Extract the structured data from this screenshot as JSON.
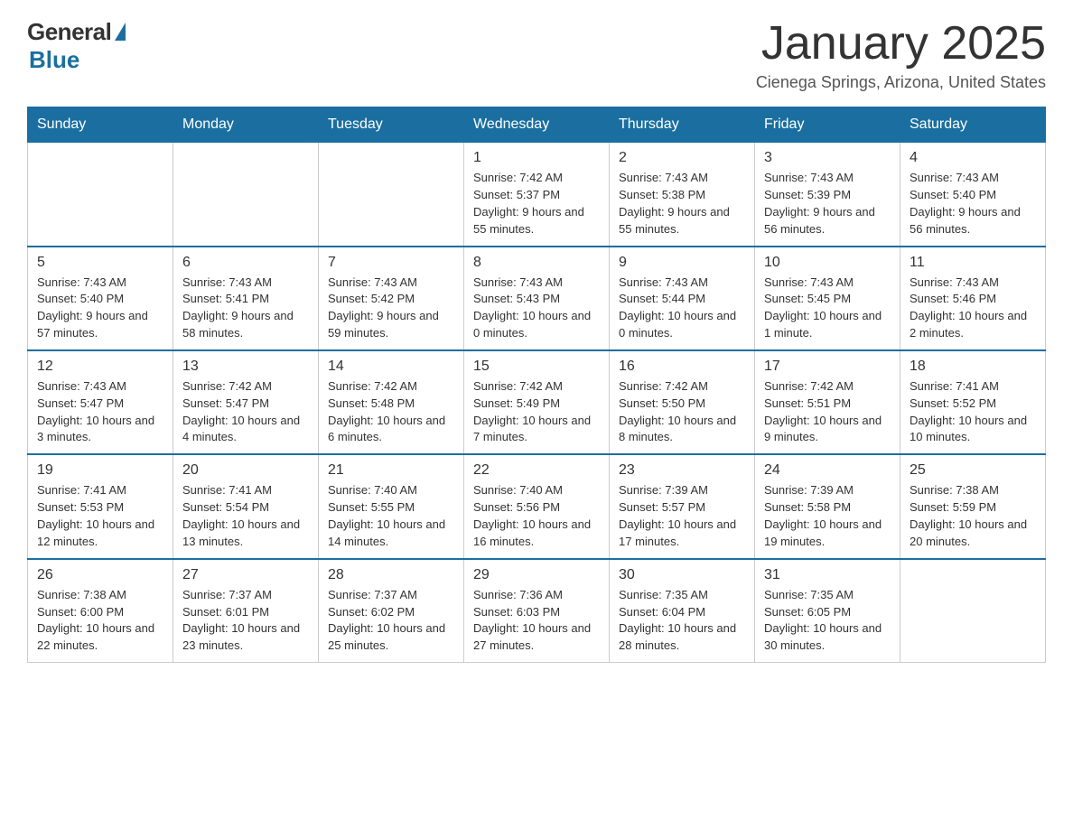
{
  "header": {
    "logo_general": "General",
    "logo_blue": "Blue",
    "month_title": "January 2025",
    "location": "Cienega Springs, Arizona, United States"
  },
  "days_of_week": [
    "Sunday",
    "Monday",
    "Tuesday",
    "Wednesday",
    "Thursday",
    "Friday",
    "Saturday"
  ],
  "weeks": [
    [
      {
        "day": "",
        "info": ""
      },
      {
        "day": "",
        "info": ""
      },
      {
        "day": "",
        "info": ""
      },
      {
        "day": "1",
        "info": "Sunrise: 7:42 AM\nSunset: 5:37 PM\nDaylight: 9 hours and 55 minutes."
      },
      {
        "day": "2",
        "info": "Sunrise: 7:43 AM\nSunset: 5:38 PM\nDaylight: 9 hours and 55 minutes."
      },
      {
        "day": "3",
        "info": "Sunrise: 7:43 AM\nSunset: 5:39 PM\nDaylight: 9 hours and 56 minutes."
      },
      {
        "day": "4",
        "info": "Sunrise: 7:43 AM\nSunset: 5:40 PM\nDaylight: 9 hours and 56 minutes."
      }
    ],
    [
      {
        "day": "5",
        "info": "Sunrise: 7:43 AM\nSunset: 5:40 PM\nDaylight: 9 hours and 57 minutes."
      },
      {
        "day": "6",
        "info": "Sunrise: 7:43 AM\nSunset: 5:41 PM\nDaylight: 9 hours and 58 minutes."
      },
      {
        "day": "7",
        "info": "Sunrise: 7:43 AM\nSunset: 5:42 PM\nDaylight: 9 hours and 59 minutes."
      },
      {
        "day": "8",
        "info": "Sunrise: 7:43 AM\nSunset: 5:43 PM\nDaylight: 10 hours and 0 minutes."
      },
      {
        "day": "9",
        "info": "Sunrise: 7:43 AM\nSunset: 5:44 PM\nDaylight: 10 hours and 0 minutes."
      },
      {
        "day": "10",
        "info": "Sunrise: 7:43 AM\nSunset: 5:45 PM\nDaylight: 10 hours and 1 minute."
      },
      {
        "day": "11",
        "info": "Sunrise: 7:43 AM\nSunset: 5:46 PM\nDaylight: 10 hours and 2 minutes."
      }
    ],
    [
      {
        "day": "12",
        "info": "Sunrise: 7:43 AM\nSunset: 5:47 PM\nDaylight: 10 hours and 3 minutes."
      },
      {
        "day": "13",
        "info": "Sunrise: 7:42 AM\nSunset: 5:47 PM\nDaylight: 10 hours and 4 minutes."
      },
      {
        "day": "14",
        "info": "Sunrise: 7:42 AM\nSunset: 5:48 PM\nDaylight: 10 hours and 6 minutes."
      },
      {
        "day": "15",
        "info": "Sunrise: 7:42 AM\nSunset: 5:49 PM\nDaylight: 10 hours and 7 minutes."
      },
      {
        "day": "16",
        "info": "Sunrise: 7:42 AM\nSunset: 5:50 PM\nDaylight: 10 hours and 8 minutes."
      },
      {
        "day": "17",
        "info": "Sunrise: 7:42 AM\nSunset: 5:51 PM\nDaylight: 10 hours and 9 minutes."
      },
      {
        "day": "18",
        "info": "Sunrise: 7:41 AM\nSunset: 5:52 PM\nDaylight: 10 hours and 10 minutes."
      }
    ],
    [
      {
        "day": "19",
        "info": "Sunrise: 7:41 AM\nSunset: 5:53 PM\nDaylight: 10 hours and 12 minutes."
      },
      {
        "day": "20",
        "info": "Sunrise: 7:41 AM\nSunset: 5:54 PM\nDaylight: 10 hours and 13 minutes."
      },
      {
        "day": "21",
        "info": "Sunrise: 7:40 AM\nSunset: 5:55 PM\nDaylight: 10 hours and 14 minutes."
      },
      {
        "day": "22",
        "info": "Sunrise: 7:40 AM\nSunset: 5:56 PM\nDaylight: 10 hours and 16 minutes."
      },
      {
        "day": "23",
        "info": "Sunrise: 7:39 AM\nSunset: 5:57 PM\nDaylight: 10 hours and 17 minutes."
      },
      {
        "day": "24",
        "info": "Sunrise: 7:39 AM\nSunset: 5:58 PM\nDaylight: 10 hours and 19 minutes."
      },
      {
        "day": "25",
        "info": "Sunrise: 7:38 AM\nSunset: 5:59 PM\nDaylight: 10 hours and 20 minutes."
      }
    ],
    [
      {
        "day": "26",
        "info": "Sunrise: 7:38 AM\nSunset: 6:00 PM\nDaylight: 10 hours and 22 minutes."
      },
      {
        "day": "27",
        "info": "Sunrise: 7:37 AM\nSunset: 6:01 PM\nDaylight: 10 hours and 23 minutes."
      },
      {
        "day": "28",
        "info": "Sunrise: 7:37 AM\nSunset: 6:02 PM\nDaylight: 10 hours and 25 minutes."
      },
      {
        "day": "29",
        "info": "Sunrise: 7:36 AM\nSunset: 6:03 PM\nDaylight: 10 hours and 27 minutes."
      },
      {
        "day": "30",
        "info": "Sunrise: 7:35 AM\nSunset: 6:04 PM\nDaylight: 10 hours and 28 minutes."
      },
      {
        "day": "31",
        "info": "Sunrise: 7:35 AM\nSunset: 6:05 PM\nDaylight: 10 hours and 30 minutes."
      },
      {
        "day": "",
        "info": ""
      }
    ]
  ]
}
